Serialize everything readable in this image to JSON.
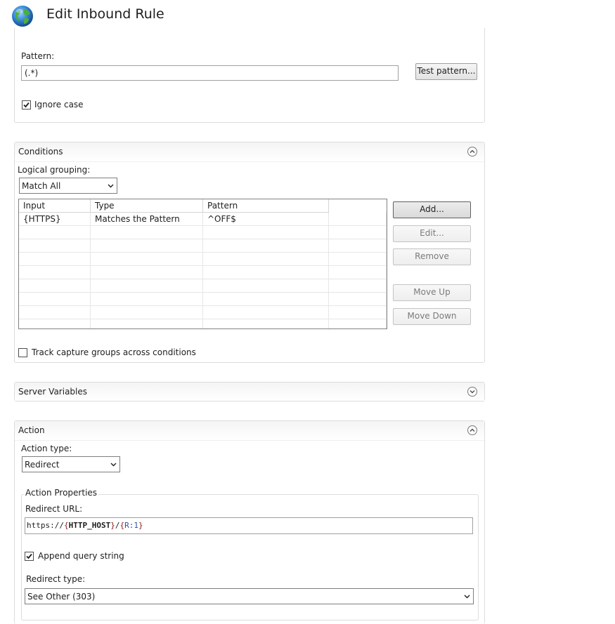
{
  "header": {
    "title": "Edit Inbound Rule",
    "icon": "globe-icon"
  },
  "match_url": {
    "pattern_label": "Pattern:",
    "pattern_value": "(.*)",
    "test_pattern_label": "Test pattern...",
    "ignore_case_label": "Ignore case",
    "ignore_case_checked": true
  },
  "conditions": {
    "title": "Conditions",
    "logical_grouping_label": "Logical grouping:",
    "logical_grouping_value": "Match All",
    "columns": [
      "Input",
      "Type",
      "Pattern"
    ],
    "rows": [
      {
        "input": "{HTTPS}",
        "type": "Matches the Pattern",
        "pattern": "^OFF$"
      }
    ],
    "buttons": {
      "add": "Add...",
      "edit": "Edit...",
      "remove": "Remove",
      "move_up": "Move Up",
      "move_down": "Move Down"
    },
    "track_capture_label": "Track capture groups across conditions",
    "track_capture_checked": false
  },
  "server_variables": {
    "title": "Server Variables"
  },
  "action": {
    "title": "Action",
    "action_type_label": "Action type:",
    "action_type_value": "Redirect",
    "properties_title": "Action Properties",
    "redirect_url_label": "Redirect URL:",
    "redirect_url": {
      "prefix": "https://",
      "open1": "{",
      "var": "HTTP_HOST",
      "close1": "}",
      "slash": "/",
      "open2": "{",
      "back": "R:1",
      "close2": "}"
    },
    "append_query_label": "Append query string",
    "append_query_checked": true,
    "redirect_type_label": "Redirect type:",
    "redirect_type_value": "See Other (303)"
  },
  "colors": {
    "accent": "#2f4fb0",
    "brace": "#8b1c1c",
    "border": "#dcdcdc"
  }
}
